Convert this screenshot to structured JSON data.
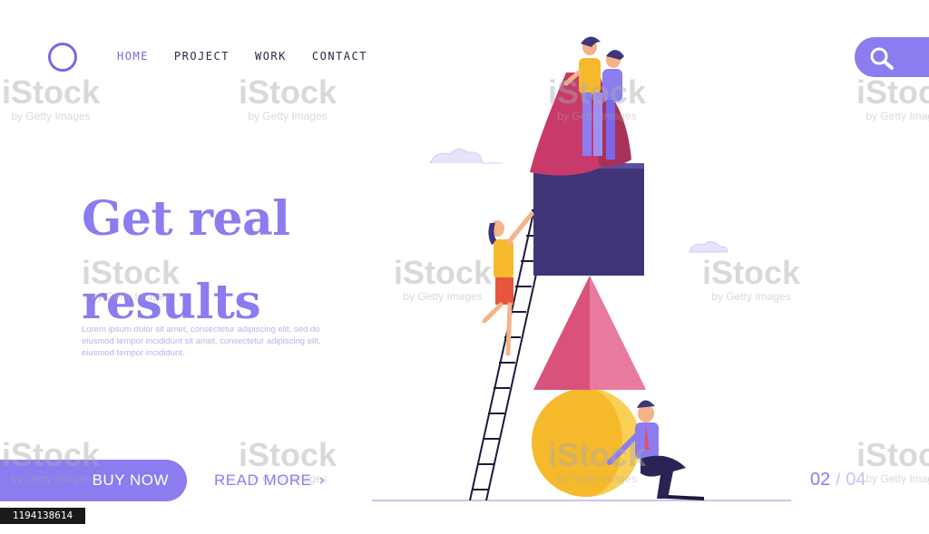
{
  "nav": {
    "items": [
      {
        "label": "HOME",
        "active": true
      },
      {
        "label": "PROJECT",
        "active": false
      },
      {
        "label": "WORK",
        "active": false
      },
      {
        "label": "CONTACT",
        "active": false
      }
    ]
  },
  "search": {
    "icon": "search-icon"
  },
  "hero": {
    "title_line1": "Get real",
    "title_line2": "results",
    "body": "Lorem ipsum dolor sit amet, consectetur adipiscing elit, sed do eiusmod tempor incididunt sit amet, consectetur adipiscing elit, eiusmod tempor incididunt."
  },
  "cta": {
    "buy_label": "BUY NOW",
    "read_more_label": "READ MORE",
    "read_more_icon": "chevron-right-icon"
  },
  "pager": {
    "current": "02",
    "separator": "/",
    "total": "04"
  },
  "watermark": {
    "brand": "iStock",
    "credit": "by Getty Images",
    "image_id": "1194138614"
  },
  "colors": {
    "accent": "#8b7cf0",
    "accent_dark": "#4a3a8c",
    "pink": "#d9527c",
    "yellow": "#f6b92b"
  }
}
